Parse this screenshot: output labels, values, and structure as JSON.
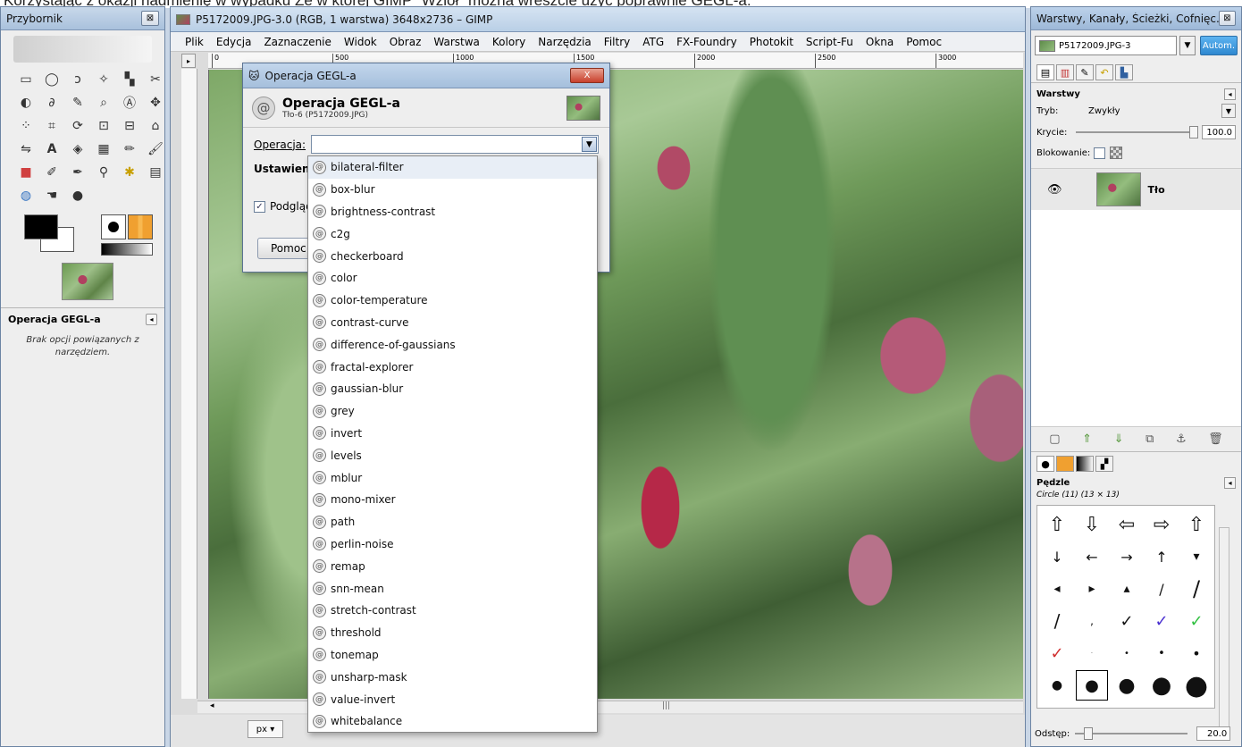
{
  "caption": "Korzystając z okazji nadmienię w wypadku Ze w której GIMP \"Wziół\" można wreszcie użyć poprawnie GEGL-a:",
  "toolbox": {
    "title": "Przybornik",
    "close": "⊠",
    "tool_options_title": "Operacja GEGL-a",
    "tool_options_text": "Brak opcji powiązanych z narzędziem."
  },
  "main": {
    "title": "P5172009.JPG-3.0 (RGB, 1 warstwa) 3648x2736 – GIMP",
    "menu": [
      "Plik",
      "Edycja",
      "Zaznaczenie",
      "Widok",
      "Obraz",
      "Warstwa",
      "Kolory",
      "Narzędzia",
      "Filtry",
      "ATG",
      "FX-Foundry",
      "Photokit",
      "Script-Fu",
      "Okna",
      "Pomoc"
    ],
    "ruler_ticks": [
      "0",
      "500",
      "1000",
      "1500",
      "2000",
      "2500",
      "3000"
    ],
    "unit": "px ▾"
  },
  "dialog": {
    "title": "Operacja GEGL-a",
    "header_title": "Operacja GEGL-a",
    "header_sub": "Tło-6 (P5172009.JPG)",
    "operation_label": "Operacja:",
    "operation_value": "",
    "settings_label": "Ustawienia",
    "preview_label": "Podgląd",
    "help_label": "Pomoc",
    "close_label": "X"
  },
  "dropdown": {
    "items": [
      "bilateral-filter",
      "box-blur",
      "brightness-contrast",
      "c2g",
      "checkerboard",
      "color",
      "color-temperature",
      "contrast-curve",
      "difference-of-gaussians",
      "fractal-explorer",
      "gaussian-blur",
      "grey",
      "invert",
      "levels",
      "mblur",
      "mono-mixer",
      "path",
      "perlin-noise",
      "remap",
      "snn-mean",
      "stretch-contrast",
      "threshold",
      "tonemap",
      "unsharp-mask",
      "value-invert",
      "whitebalance"
    ],
    "selected_index": 0
  },
  "dock": {
    "title": "Warstwy, Kanały, Ścieżki, Cofnięc...",
    "image_select": "P5172009.JPG-3",
    "auto_button": "Autom.",
    "layers_title": "Warstwy",
    "mode_label": "Tryb:",
    "mode_value": "Zwykły",
    "opacity_label": "Krycie:",
    "opacity_value": "100.0",
    "lock_label": "Blokowanie:",
    "layer_name": "Tło",
    "brushes_title": "Pędzle",
    "brush_info": "Circle (11) (13 × 13)",
    "spacing_label": "Odstęp:",
    "spacing_value": "20.0"
  }
}
